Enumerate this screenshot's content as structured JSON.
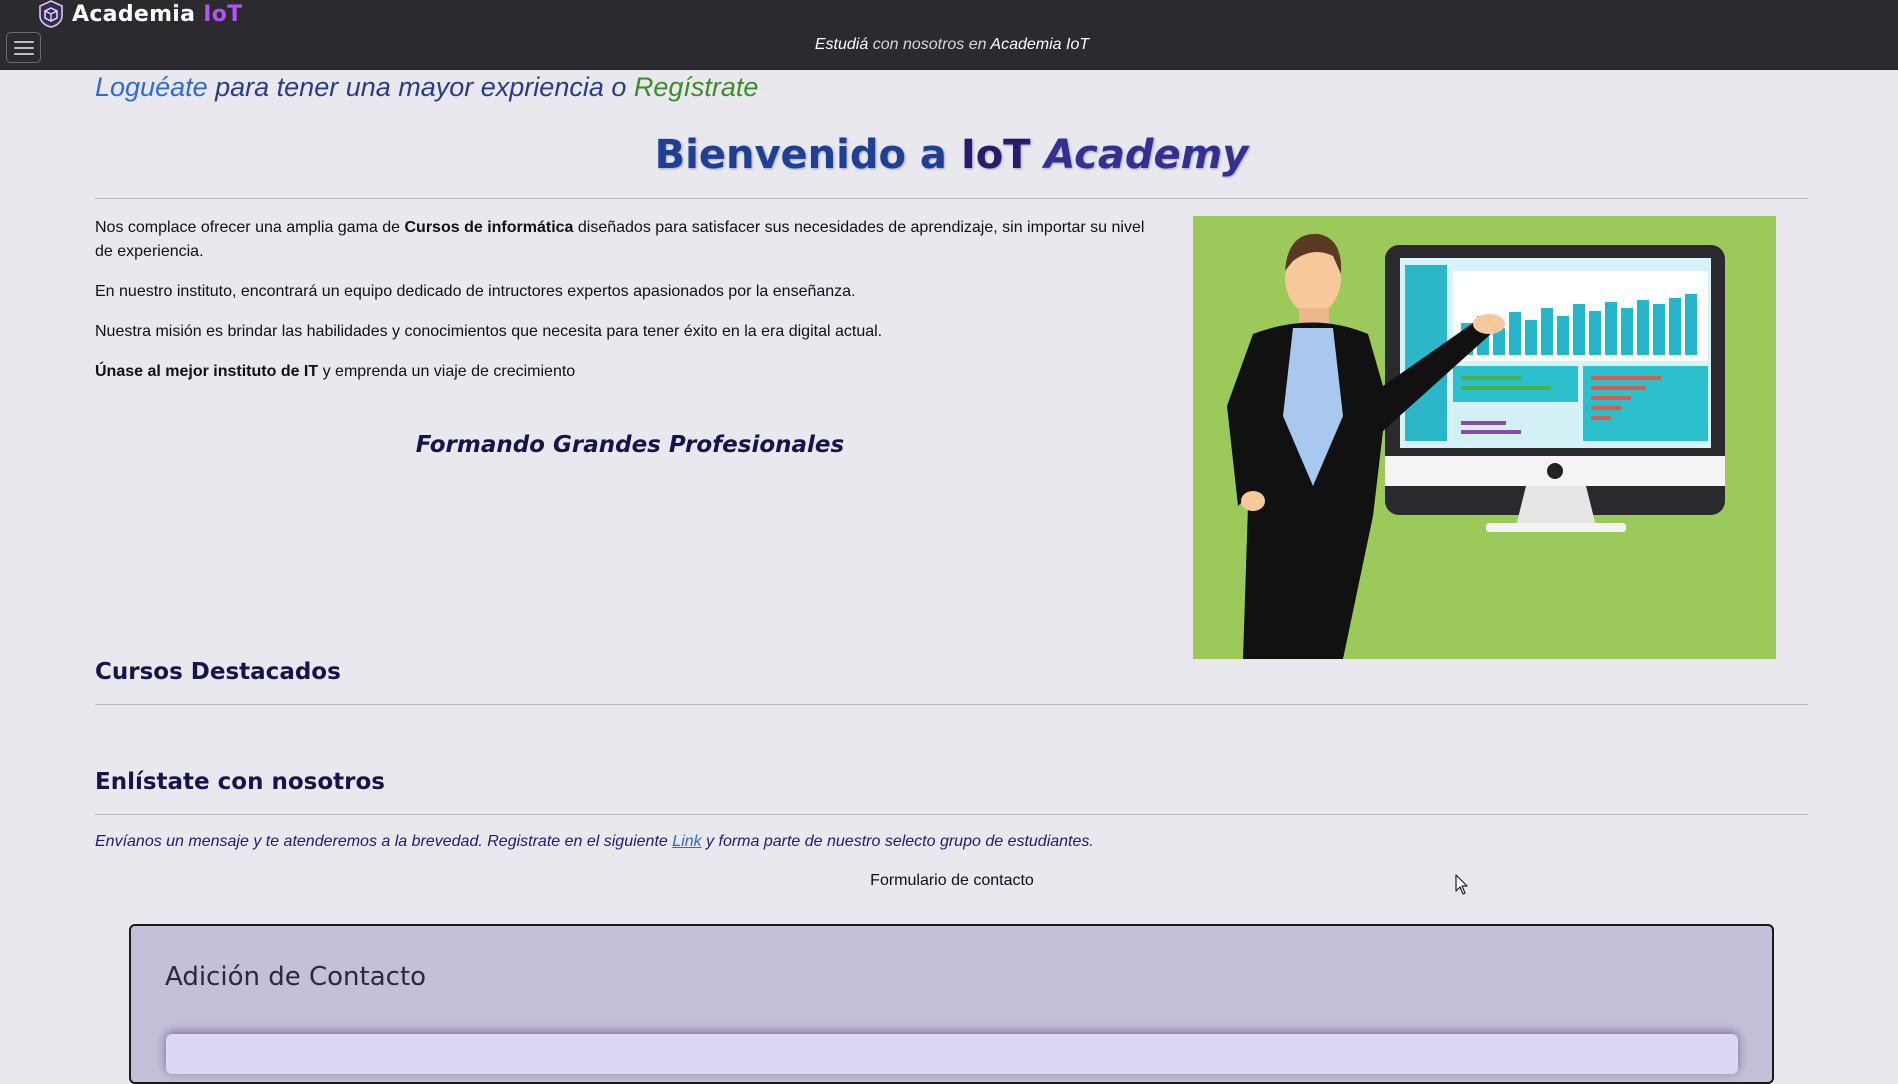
{
  "navbar": {
    "brand_main": "Academia ",
    "brand_accent": "IoT",
    "tagline_1": "Estudiá",
    "tagline_2": " con nosotros en ",
    "tagline_3": "Academia IoT",
    "logo_icon": "shield-cube-icon",
    "menu_icon": "hamburger-menu-icon"
  },
  "login": {
    "login_link": "Loguéate",
    "middle": " para tener una mayor expriencia o ",
    "register_link": "Regístrate"
  },
  "welcome": {
    "prefix": "Bienvenido a ",
    "iot": "IoT ",
    "academy": "Academy"
  },
  "intro": {
    "p1_a": "Nos complace ofrecer una amplia gama de ",
    "p1_b": "Cursos de informática",
    "p1_c": " diseñados para satisfacer sus necesidades de aprendizaje, sin importar su nivel de experiencia.",
    "p2": "En nuestro instituto, encontrará un equipo dedicado de intructores expertos apasionados por la enseñanza.",
    "p3": "Nuestra misión es brindar las habilidades y conocimientos que necesita para tener éxito en la era digital actual.",
    "p4_a": "Únase al mejor instituto de IT",
    "p4_b": " y emprenda un viaje de crecimiento",
    "slogan": "Formando Grandes Profesionales"
  },
  "sections": {
    "featured": "Cursos Destacados",
    "enlist": "Enlístate con nosotros",
    "enlist_text_a": "Envíanos un mensaje y te atenderemos a la brevedad. Registrate en el siguiente ",
    "enlist_link": "Link",
    "enlist_text_b": " y forma parte de nuestro selecto grupo de estudiantes.",
    "form_caption": "Formulario de contacto"
  },
  "contact": {
    "title": "Adición de Contacto"
  },
  "colors": {
    "navbar_bg": "#2b2b2f",
    "page_bg": "#e8e8ee",
    "brand_accent": "#b056f5",
    "link_blue": "#2f6bd8",
    "register_green": "#3d8b2a",
    "hero_green": "#9bca5a"
  }
}
